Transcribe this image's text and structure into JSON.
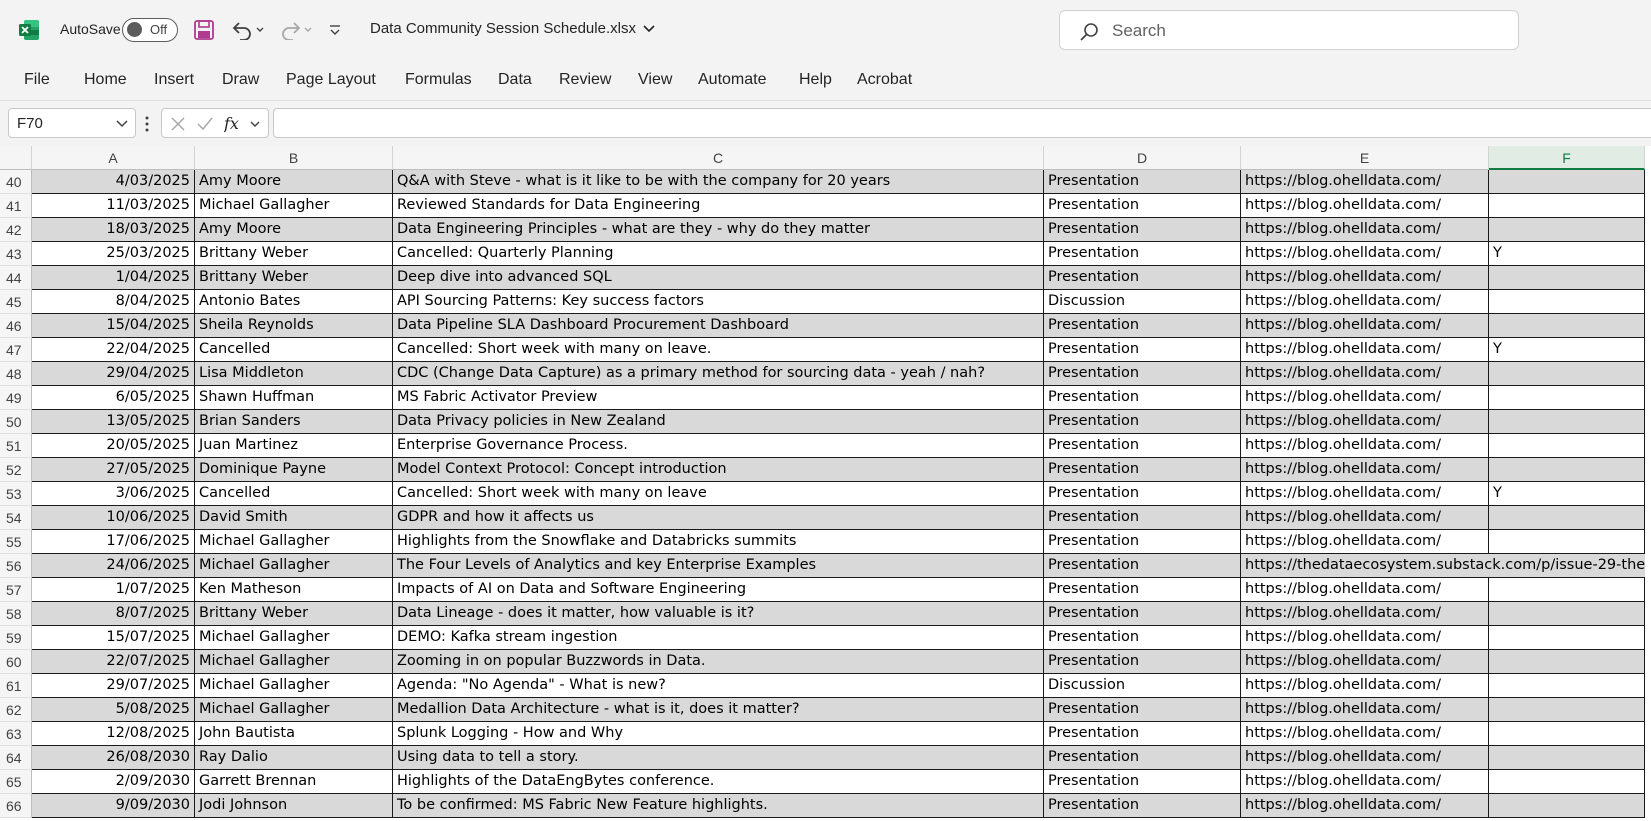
{
  "app": {
    "autosave_label": "AutoSave",
    "autosave_state": "Off",
    "file_name": "Data Community Session Schedule.xlsx",
    "search_placeholder": "Search",
    "accent_color": "#107c41"
  },
  "ribbon": {
    "tabs": [
      "File",
      "Home",
      "Insert",
      "Draw",
      "Page Layout",
      "Formulas",
      "Data",
      "Review",
      "View",
      "Automate",
      "Help",
      "Acrobat"
    ]
  },
  "formula_bar": {
    "name_box": "F70",
    "formula": ""
  },
  "sheet": {
    "columns": [
      "A",
      "B",
      "C",
      "D",
      "E",
      "F"
    ],
    "selected_column": "F",
    "rows": [
      {
        "n": "40",
        "date": "4/03/2025",
        "presenter": "Amy Moore",
        "topic": "Q&A with Steve - what is it like to be with the company for 20 years",
        "type": "Presentation",
        "link": "https://blog.ohelldata.com/",
        "flag": ""
      },
      {
        "n": "41",
        "date": "11/03/2025",
        "presenter": "Michael Gallagher",
        "topic": "Reviewed Standards for Data Engineering",
        "type": "Presentation",
        "link": "https://blog.ohelldata.com/",
        "flag": ""
      },
      {
        "n": "42",
        "date": "18/03/2025",
        "presenter": "Amy Moore",
        "topic": "Data Engineering Principles - what are they - why do they matter",
        "type": "Presentation",
        "link": "https://blog.ohelldata.com/",
        "flag": ""
      },
      {
        "n": "43",
        "date": "25/03/2025",
        "presenter": "Brittany Weber",
        "topic": "Cancelled: Quarterly Planning",
        "type": "Presentation",
        "link": "https://blog.ohelldata.com/",
        "flag": "Y"
      },
      {
        "n": "44",
        "date": "1/04/2025",
        "presenter": "Brittany Weber",
        "topic": "Deep dive into advanced SQL",
        "type": "Presentation",
        "link": "https://blog.ohelldata.com/",
        "flag": ""
      },
      {
        "n": "45",
        "date": "8/04/2025",
        "presenter": "Antonio Bates",
        "topic": "API Sourcing Patterns: Key success factors",
        "type": "Discussion",
        "link": "https://blog.ohelldata.com/",
        "flag": ""
      },
      {
        "n": "46",
        "date": "15/04/2025",
        "presenter": "Sheila Reynolds",
        "topic": "Data Pipeline SLA Dashboard Procurement Dashboard",
        "type": "Presentation",
        "link": "https://blog.ohelldata.com/",
        "flag": ""
      },
      {
        "n": "47",
        "date": "22/04/2025",
        "presenter": "Cancelled",
        "topic": "Cancelled: Short week with many on leave.",
        "type": "Presentation",
        "link": "https://blog.ohelldata.com/",
        "flag": "Y"
      },
      {
        "n": "48",
        "date": "29/04/2025",
        "presenter": "Lisa Middleton",
        "topic": "CDC (Change Data Capture) as a primary method for sourcing data - yeah / nah?",
        "type": "Presentation",
        "link": "https://blog.ohelldata.com/",
        "flag": ""
      },
      {
        "n": "49",
        "date": "6/05/2025",
        "presenter": "Shawn Huffman",
        "topic": "MS Fabric Activator Preview",
        "type": "Presentation",
        "link": "https://blog.ohelldata.com/",
        "flag": ""
      },
      {
        "n": "50",
        "date": "13/05/2025",
        "presenter": "Brian Sanders",
        "topic": "Data Privacy policies in New Zealand",
        "type": "Presentation",
        "link": "https://blog.ohelldata.com/",
        "flag": ""
      },
      {
        "n": "51",
        "date": "20/05/2025",
        "presenter": "Juan Martinez",
        "topic": "Enterprise Governance Process.",
        "type": "Presentation",
        "link": "https://blog.ohelldata.com/",
        "flag": ""
      },
      {
        "n": "52",
        "date": "27/05/2025",
        "presenter": "Dominique Payne",
        "topic": "Model Context Protocol: Concept introduction",
        "type": "Presentation",
        "link": "https://blog.ohelldata.com/",
        "flag": ""
      },
      {
        "n": "53",
        "date": "3/06/2025",
        "presenter": "Cancelled",
        "topic": "Cancelled: Short week with many on leave",
        "type": "Presentation",
        "link": "https://blog.ohelldata.com/",
        "flag": "Y"
      },
      {
        "n": "54",
        "date": "10/06/2025",
        "presenter": "David Smith",
        "topic": "GDPR and how it affects us",
        "type": "Presentation",
        "link": "https://blog.ohelldata.com/",
        "flag": ""
      },
      {
        "n": "55",
        "date": "17/06/2025",
        "presenter": "Michael Gallagher",
        "topic": "Highlights from the Snowflake and Databricks summits",
        "type": "Presentation",
        "link": "https://blog.ohelldata.com/",
        "flag": ""
      },
      {
        "n": "56",
        "date": "24/06/2025",
        "presenter": "Michael Gallagher",
        "topic": "The Four Levels of Analytics and key Enterprise Examples",
        "type": "Presentation",
        "link": "https://thedataecosystem.substack.com/p/issue-29-the",
        "flag": ""
      },
      {
        "n": "57",
        "date": "1/07/2025",
        "presenter": "Ken Matheson",
        "topic": "Impacts of AI on Data and Software Engineering",
        "type": "Presentation",
        "link": "https://blog.ohelldata.com/",
        "flag": ""
      },
      {
        "n": "58",
        "date": "8/07/2025",
        "presenter": "Brittany Weber",
        "topic": "Data Lineage - does it matter, how valuable is it?",
        "type": "Presentation",
        "link": "https://blog.ohelldata.com/",
        "flag": ""
      },
      {
        "n": "59",
        "date": "15/07/2025",
        "presenter": "Michael Gallagher",
        "topic": "DEMO: Kafka stream ingestion",
        "type": "Presentation",
        "link": "https://blog.ohelldata.com/",
        "flag": ""
      },
      {
        "n": "60",
        "date": "22/07/2025",
        "presenter": "Michael Gallagher",
        "topic": "Zooming in on popular Buzzwords in Data.",
        "type": "Presentation",
        "link": "https://blog.ohelldata.com/",
        "flag": ""
      },
      {
        "n": "61",
        "date": "29/07/2025",
        "presenter": "Michael Gallagher",
        "topic": "Agenda: \"No Agenda\" - What is new?",
        "type": "Discussion",
        "link": "https://blog.ohelldata.com/",
        "flag": ""
      },
      {
        "n": "62",
        "date": "5/08/2025",
        "presenter": "Michael Gallagher",
        "topic": "Medallion Data Architecture - what is it, does it matter?",
        "type": "Presentation",
        "link": "https://blog.ohelldata.com/",
        "flag": ""
      },
      {
        "n": "63",
        "date": "12/08/2025",
        "presenter": "John Bautista",
        "topic": "Splunk Logging - How and Why",
        "type": "Presentation",
        "link": "https://blog.ohelldata.com/",
        "flag": ""
      },
      {
        "n": "64",
        "date": "26/08/2030",
        "presenter": "Ray Dalio",
        "topic": "Using data to tell a story.",
        "type": "Presentation",
        "link": "https://blog.ohelldata.com/",
        "flag": ""
      },
      {
        "n": "65",
        "date": "2/09/2030",
        "presenter": "Garrett Brennan",
        "topic": "Highlights of the DataEngBytes conference.",
        "type": "Presentation",
        "link": "https://blog.ohelldata.com/",
        "flag": ""
      },
      {
        "n": "66",
        "date": "9/09/2030",
        "presenter": "Jodi Johnson",
        "topic": "To be confirmed: MS Fabric New Feature highlights.",
        "type": "Presentation",
        "link": "https://blog.ohelldata.com/",
        "flag": ""
      }
    ]
  }
}
